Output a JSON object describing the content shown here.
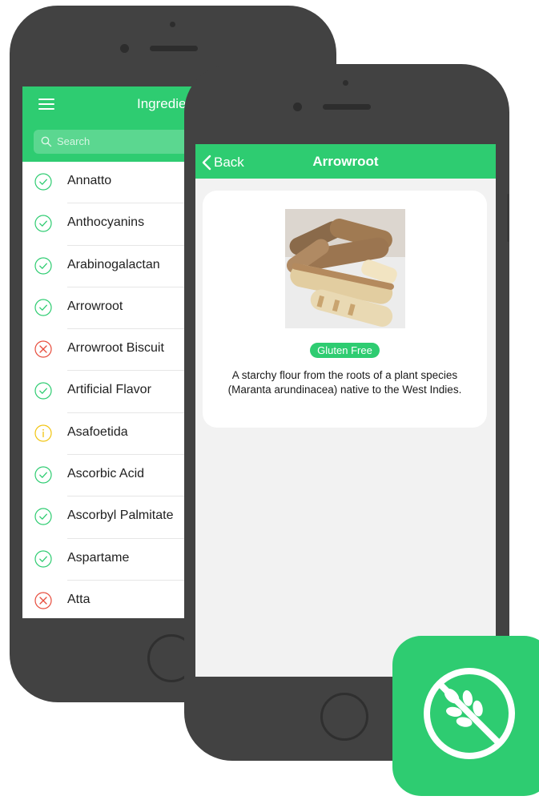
{
  "colors": {
    "brand_green": "#2ecc71",
    "phone_body": "#424242",
    "success": "#2ecc71",
    "danger": "#e74c3c",
    "warning": "#f1c40f"
  },
  "list_screen": {
    "title": "Ingredients",
    "search_placeholder": "Search",
    "items": [
      {
        "name": "Annatto",
        "status": "safe"
      },
      {
        "name": "Anthocyanins",
        "status": "safe"
      },
      {
        "name": "Arabinogalactan",
        "status": "safe"
      },
      {
        "name": "Arrowroot",
        "status": "safe"
      },
      {
        "name": "Arrowroot Biscuit",
        "status": "unsafe"
      },
      {
        "name": "Artificial Flavor",
        "status": "safe"
      },
      {
        "name": "Asafoetida",
        "status": "caution"
      },
      {
        "name": "Ascorbic Acid",
        "status": "safe"
      },
      {
        "name": "Ascorbyl Palmitate",
        "status": "safe"
      },
      {
        "name": "Aspartame",
        "status": "safe"
      },
      {
        "name": "Atta",
        "status": "unsafe"
      }
    ]
  },
  "detail_screen": {
    "back_label": "Back",
    "title": "Arrowroot",
    "badge": "Gluten Free",
    "description": "A starchy flour from the roots of a plant species (Maranta arundinacea) native to the West Indies."
  },
  "icons": {
    "menu": "hamburger-icon",
    "search": "search-icon",
    "back": "chevron-left-icon",
    "safe": "check-circle-icon",
    "unsafe": "x-circle-icon",
    "caution": "info-circle-icon",
    "app": "no-wheat-icon"
  }
}
